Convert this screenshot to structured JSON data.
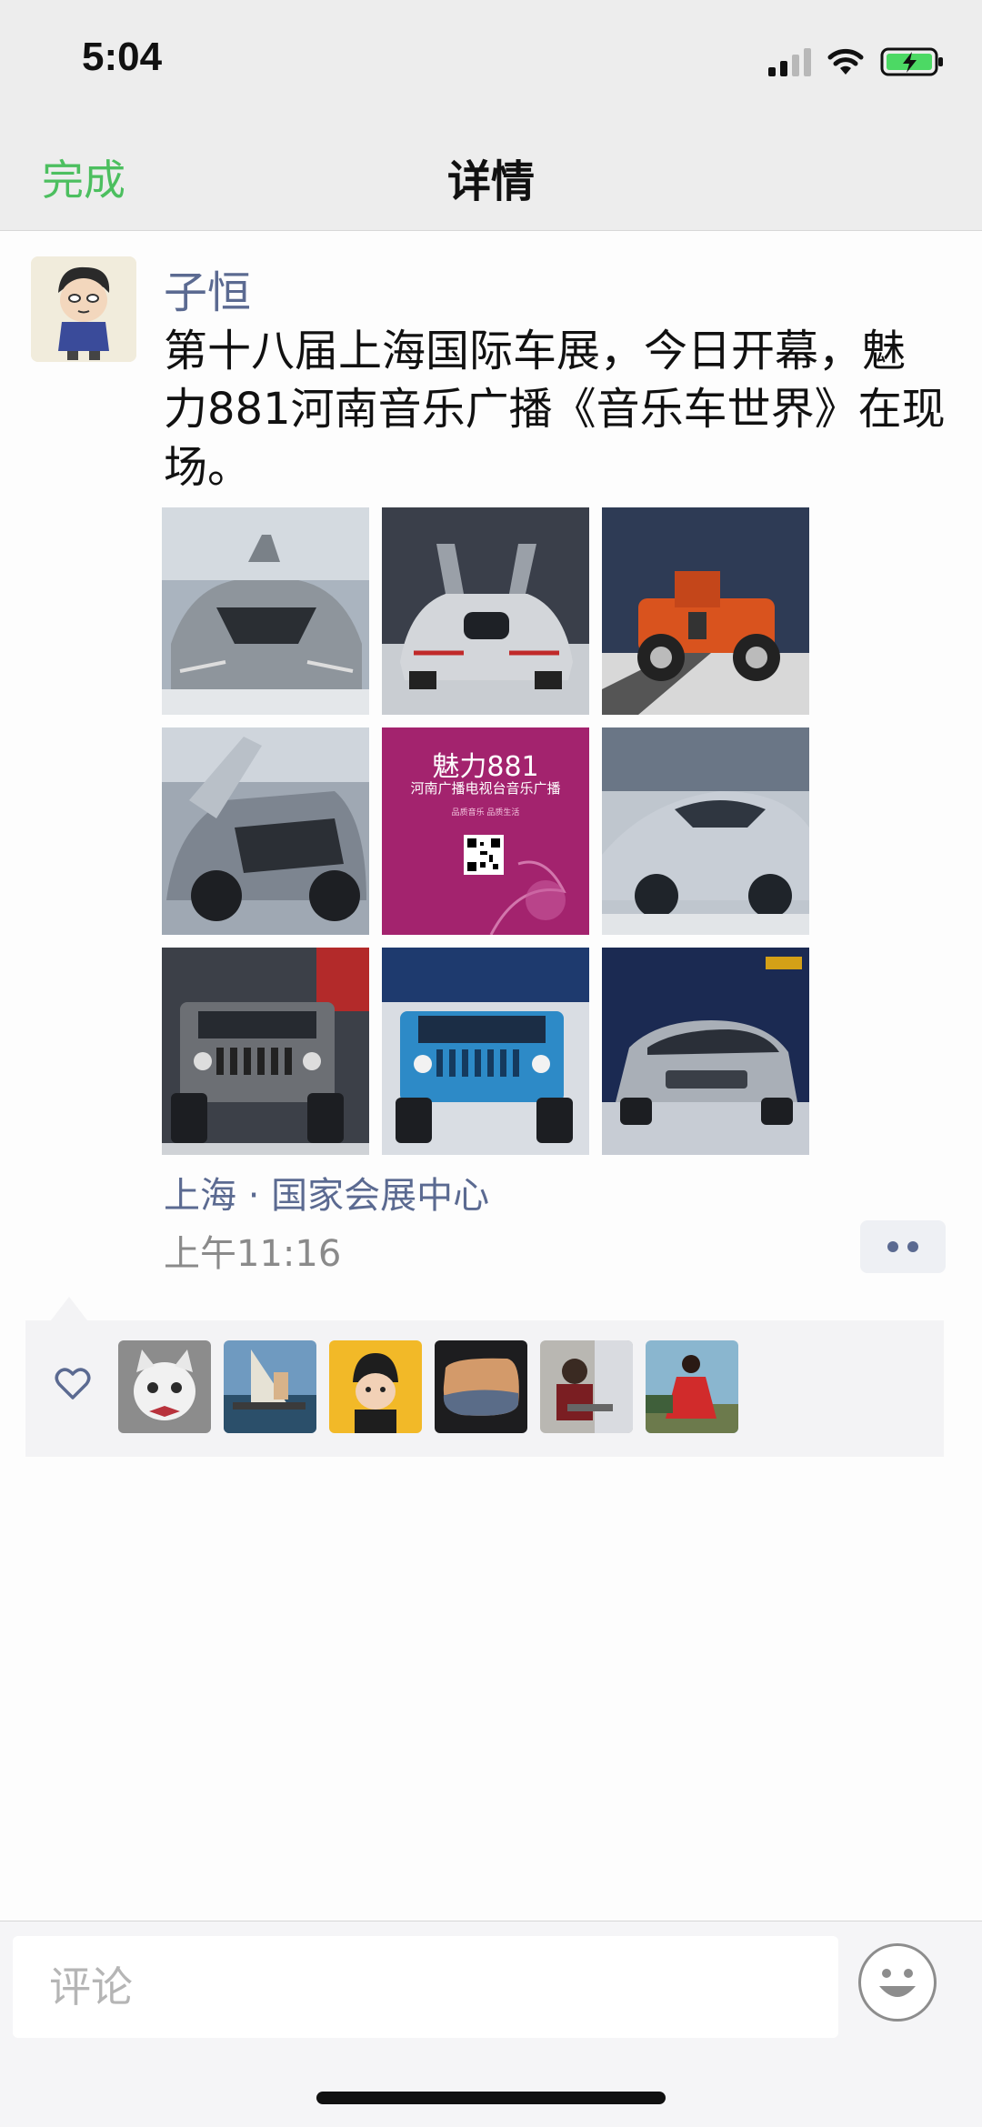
{
  "status_bar": {
    "time": "5:04",
    "icons": [
      "signal-icon",
      "wifi-icon",
      "battery-charging-icon"
    ]
  },
  "nav": {
    "done_label": "完成",
    "title": "详情"
  },
  "post": {
    "author": "子恒",
    "text": "第十八届上海国际车展，今日开幕，魅力881河南音乐广播《音乐车世界》在现场。",
    "photos": [
      {
        "name": "photo-silver-supercar-front"
      },
      {
        "name": "photo-silver-supercar-rear"
      },
      {
        "name": "photo-orange-vintage-car"
      },
      {
        "name": "photo-concept-car-open-door"
      },
      {
        "name": "photo-radio-poster",
        "poster_title": "魅力881",
        "poster_subtitle": "河南广播电视台音乐广播",
        "poster_tagline": "品质音乐 品质生活"
      },
      {
        "name": "photo-silver-race-car"
      },
      {
        "name": "photo-gray-jeep"
      },
      {
        "name": "photo-blue-jeep"
      },
      {
        "name": "photo-silver-suv"
      }
    ],
    "location": "上海 · 国家会展中心",
    "time": "上午11:16"
  },
  "likes": {
    "icon": "heart-outline-icon",
    "avatars": [
      "liker-cat",
      "liker-sailing",
      "liker-baby",
      "liker-car-mirror",
      "liker-man-laptop",
      "liker-woman-red"
    ]
  },
  "comment_bar": {
    "placeholder": "评论",
    "emoji_icon": "smiley-face-icon"
  },
  "colors": {
    "accent_green": "#4cbf5f",
    "link_blue": "#5b6a91",
    "bar_gray": "#ededed"
  }
}
